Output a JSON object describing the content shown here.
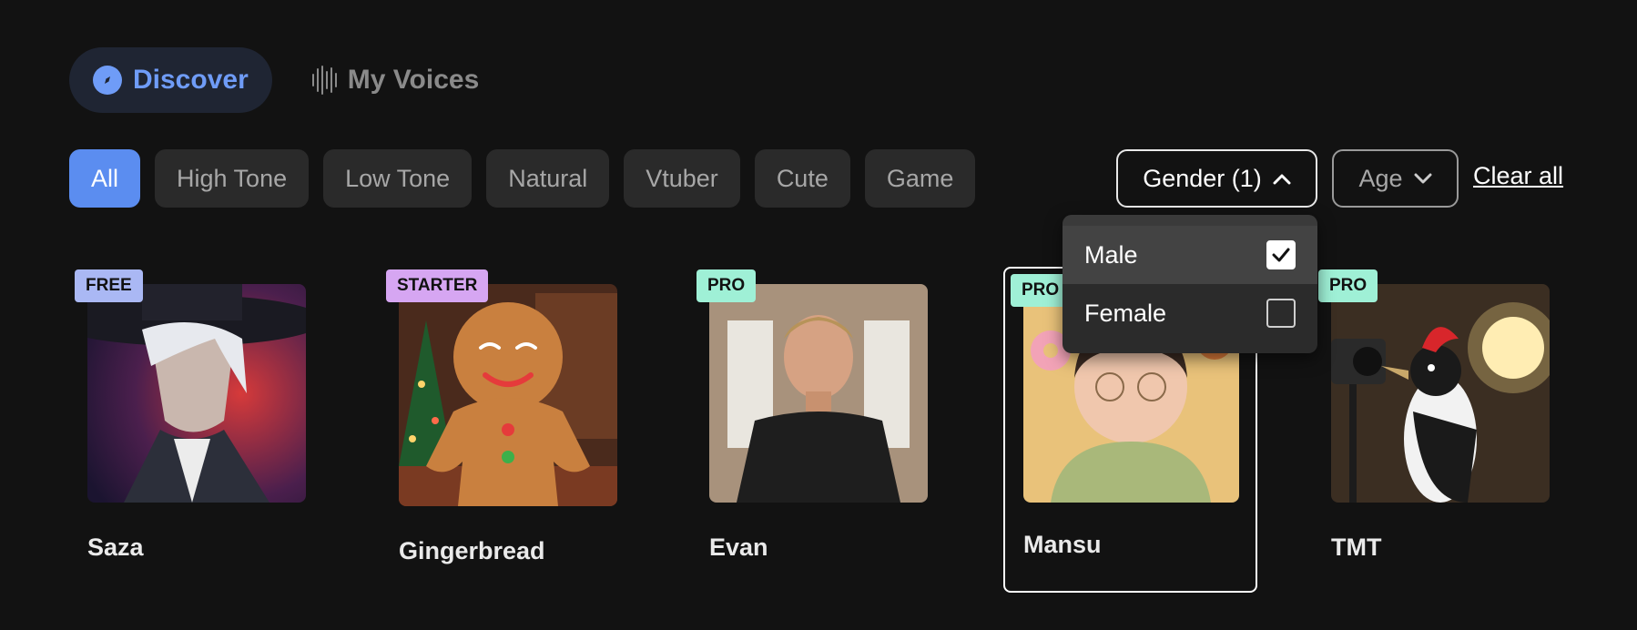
{
  "tabs": {
    "discover_label": "Discover",
    "my_voices_label": "My Voices"
  },
  "chips": [
    "All",
    "High Tone",
    "Low Tone",
    "Natural",
    "Vtuber",
    "Cute",
    "Game"
  ],
  "filters": {
    "gender_label": "Gender (1)",
    "age_label": "Age",
    "clear_all_label": "Clear all"
  },
  "gender_dropdown": {
    "options": [
      {
        "label": "Male",
        "checked": true
      },
      {
        "label": "Female",
        "checked": false
      }
    ]
  },
  "voices": [
    {
      "name": "Saza",
      "badge": "FREE"
    },
    {
      "name": "Gingerbread",
      "badge": "STARTER"
    },
    {
      "name": "Evan",
      "badge": "PRO"
    },
    {
      "name": "Mansu",
      "badge": "PRO"
    },
    {
      "name": "TMT",
      "badge": "PRO"
    }
  ],
  "colors": {
    "accent": "#5b8df0",
    "background": "#121212",
    "chip_bg": "#2a2a2a",
    "badge_free": "#aab8f4",
    "badge_starter": "#d6a6f2",
    "badge_pro": "#9ff0d6"
  }
}
